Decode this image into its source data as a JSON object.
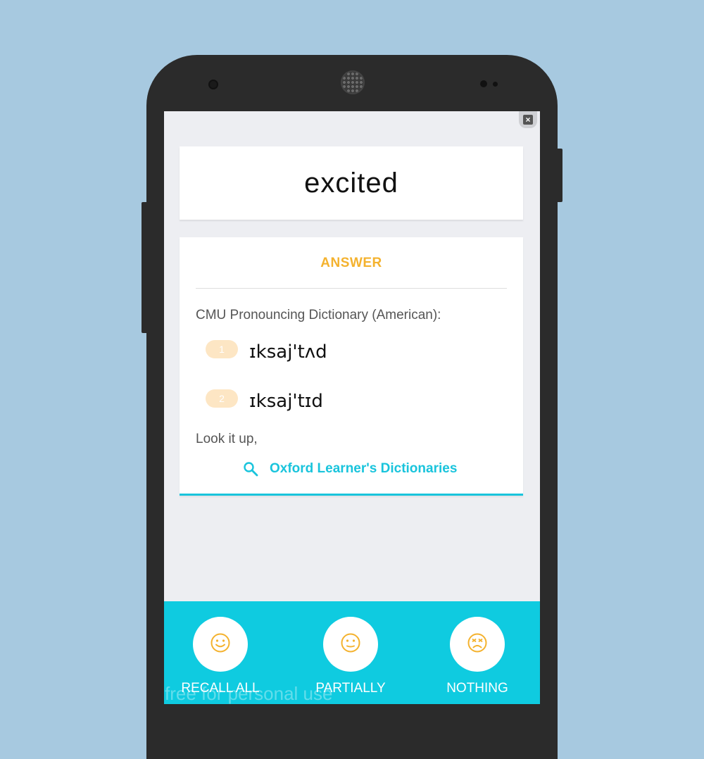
{
  "card": {
    "word": "excited",
    "close_symbol": "×"
  },
  "answer": {
    "title": "ANSWER",
    "dictionary_label": "CMU Pronouncing Dictionary (American):",
    "pronunciations": [
      {
        "index": "1",
        "ipa": "ɪksaj'tʌd"
      },
      {
        "index": "2",
        "ipa": "ɪksaj'tɪd"
      }
    ],
    "lookup_label": "Look it up,",
    "link_label": "Oxford Learner's Dictionaries"
  },
  "rating": {
    "buttons": [
      {
        "label": "RECALL ALL",
        "icon": "smile-icon"
      },
      {
        "label": "PARTIALLY",
        "icon": "neutral-face-icon"
      },
      {
        "label": "NOTHING",
        "icon": "sad-face-icon"
      }
    ]
  },
  "watermark": "free for personal use",
  "colors": {
    "background": "#a7c9e0",
    "accent": "#19c4dc",
    "answer_title": "#f4b22e",
    "badge": "#fde6c4",
    "bottom_bar": "#0fcbe0",
    "face_icon": "#f4b22e"
  }
}
